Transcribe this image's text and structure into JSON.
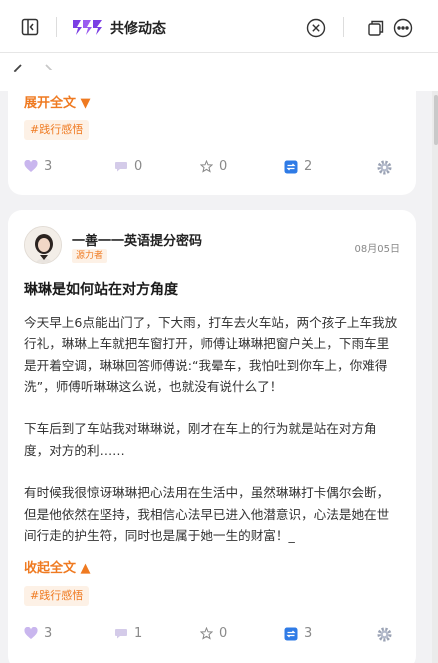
{
  "window": {
    "title": "共修动态"
  },
  "cards": [
    {
      "expand_label": "展开全文 ▼",
      "tag": "#践行感悟",
      "stats": {
        "likes": "3",
        "comments": "0",
        "favorites": "0",
        "shares": "2"
      }
    },
    {
      "author": "一善一一英语提分密码",
      "role": "源力者",
      "date": "08月05日",
      "title": "琳琳是如何站在对方角度",
      "body": [
        "今天早上6点能出门了，下大雨，打车去火车站，两个孩子上车我放行礼，琳琳上车就把车窗打开，师傅让琳琳把窗户关上，下雨车里是开着空调，琳琳回答师傅说:“我晕车，我怕吐到你车上，你难得洗”，师傅听琳琳这么说，也就没有说什么了！",
        "",
        "下车后到了车站我对琳琳说，刚才在车上的行为就是站在对方角度，对方的利……",
        "",
        "有时候我很惊讶琳琳把心法用在生活中，虽然琳琳打卡偶尔会断，但是他依然在坚持，我相信心法早已进入他潜意识，心法是她在世间行走的护生符，同时也是属于她一生的财富！_"
      ],
      "collapse_label": "收起全文 ▲",
      "tag": "#践行感悟",
      "stats": {
        "likes": "3",
        "comments": "1",
        "favorites": "0",
        "shares": "3"
      }
    }
  ],
  "colors": {
    "accent": "#ef7a21",
    "logo": "#7b3fe4",
    "share": "#2f7be6",
    "like": "#b9a4e8"
  },
  "icons": [
    "sidebar-toggle-icon",
    "app-logo-icon",
    "close-circle-icon",
    "new-window-icon",
    "more-icon",
    "back-arrow-icon",
    "forward-arrow-icon",
    "heart-icon",
    "comment-icon",
    "star-icon",
    "share-icon",
    "settings-gear-icon"
  ]
}
